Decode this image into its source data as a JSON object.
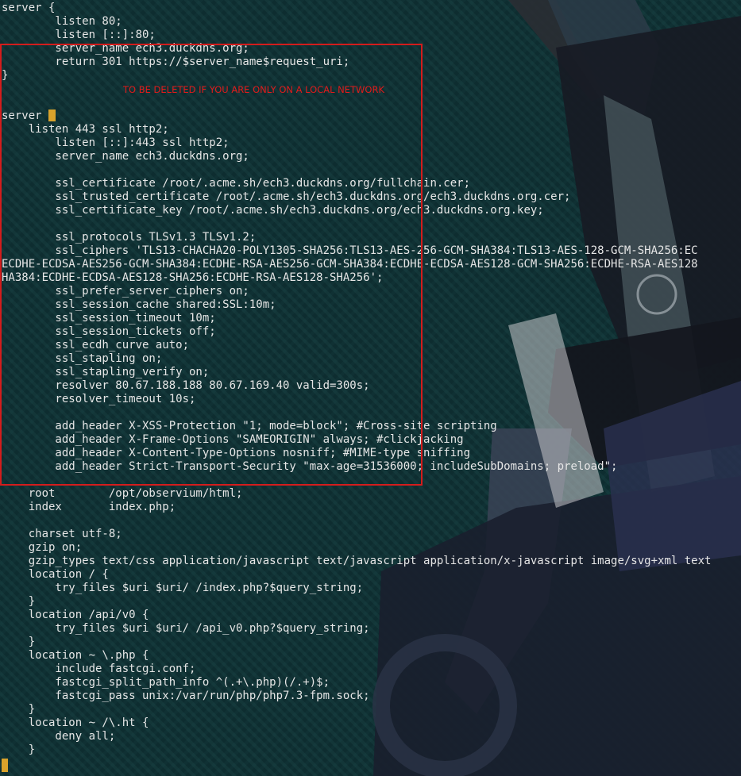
{
  "editor": {
    "lines": [
      "server {",
      "        listen 80;",
      "        listen [::]:80;",
      "        server_name ech3.duckdns.org;",
      "        return 301 https://$server_name$request_uri;",
      "}",
      "",
      "",
      "server ",
      "    listen 443 ssl http2;",
      "        listen [::]:443 ssl http2;",
      "        server_name ech3.duckdns.org;",
      "",
      "        ssl_certificate /root/.acme.sh/ech3.duckdns.org/fullchain.cer;",
      "        ssl_trusted_certificate /root/.acme.sh/ech3.duckdns.org/ech3.duckdns.org.cer;",
      "        ssl_certificate_key /root/.acme.sh/ech3.duckdns.org/ech3.duckdns.org.key;",
      "",
      "        ssl_protocols TLSv1.3 TLSv1.2;",
      "        ssl_ciphers 'TLS13-CHACHA20-POLY1305-SHA256:TLS13-AES-256-GCM-SHA384:TLS13-AES-128-GCM-SHA256:EC",
      "ECDHE-ECDSA-AES256-GCM-SHA384:ECDHE-RSA-AES256-GCM-SHA384:ECDHE-ECDSA-AES128-GCM-SHA256:ECDHE-RSA-AES128",
      "HA384:ECDHE-ECDSA-AES128-SHA256:ECDHE-RSA-AES128-SHA256';",
      "        ssl_prefer_server_ciphers on;",
      "        ssl_session_cache shared:SSL:10m;",
      "        ssl_session_timeout 10m;",
      "        ssl_session_tickets off;",
      "        ssl_ecdh_curve auto;",
      "        ssl_stapling on;",
      "        ssl_stapling_verify on;",
      "        resolver 80.67.188.188 80.67.169.40 valid=300s;",
      "        resolver_timeout 10s;",
      "",
      "        add_header X-XSS-Protection \"1; mode=block\"; #Cross-site scripting",
      "        add_header X-Frame-Options \"SAMEORIGIN\" always; #clickjacking",
      "        add_header X-Content-Type-Options nosniff; #MIME-type sniffing",
      "        add_header Strict-Transport-Security \"max-age=31536000; includeSubDomains; preload\";",
      "",
      "    root        /opt/observium/html;",
      "    index       index.php;",
      "",
      "    charset utf-8;",
      "    gzip on;",
      "    gzip_types text/css application/javascript text/javascript application/x-javascript image/svg+xml text",
      "    location / {",
      "        try_files $uri $uri/ /index.php?$query_string;",
      "    }",
      "    location /api/v0 {",
      "        try_files $uri $uri/ /api_v0.php?$query_string;",
      "    }",
      "    location ~ \\.php {",
      "        include fastcgi.conf;",
      "        fastcgi_split_path_info ^(.+\\.php)(/.+)$;",
      "        fastcgi_pass unix:/var/run/php/php7.3-fpm.sock;",
      "    }",
      "    location ~ /\\.ht {",
      "        deny all;",
      "    }"
    ],
    "cursor_char": "{"
  },
  "annotation": {
    "note": "TO BE DELETED IF YOU ARE ONLY ON A LOCAL NETWORK",
    "color": "#e01b1b"
  },
  "colors": {
    "text": "#e6e6e6",
    "cursor": "#d9a22b",
    "background": "#0e2d30"
  }
}
